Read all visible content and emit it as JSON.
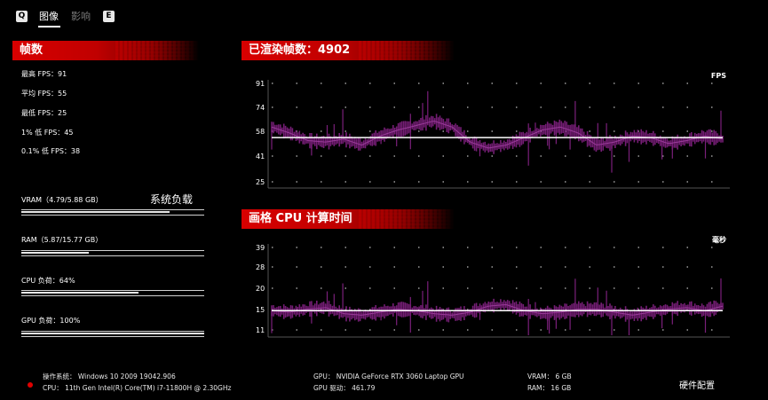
{
  "tabs": [
    {
      "key": "Q"
    },
    {
      "label": "图像"
    },
    {
      "label": "影响"
    },
    {
      "key": "E"
    }
  ],
  "frames_panel": {
    "title": "帧数",
    "stats": [
      "最高 FPS：91",
      "平均 FPS：55",
      "最低 FPS：25",
      "1% 低 FPS：45",
      "0.1% 低 FPS：38"
    ]
  },
  "system_load": {
    "title": "系统负载",
    "items": [
      {
        "label": "VRAM（4.79/5.88 GB）",
        "fraction": 0.81
      },
      {
        "label": "RAM（5.87/15.77 GB）",
        "fraction": 0.37
      },
      {
        "label": "CPU 负荷：64%",
        "fraction": 0.64
      },
      {
        "label": "GPU 负荷：100%",
        "fraction": 1.0
      }
    ]
  },
  "fps_chart": {
    "header": "已渲染帧数：4902",
    "unit": "FPS",
    "ticks": [
      "91",
      "74",
      "58",
      "41",
      "25"
    ],
    "line_color": "#7a1f7a",
    "avg_color": "#ffffff"
  },
  "cpu_chart": {
    "header": "画格 CPU 计算时间",
    "unit": "毫秒",
    "ticks": [
      "39",
      "28",
      "20",
      "15",
      "11"
    ],
    "line_color": "#7a1f7a",
    "avg_color": "#ffffff"
  },
  "chart_data": [
    {
      "type": "line",
      "title": "已渲染帧数：4902",
      "ylabel": "FPS",
      "yticks": [
        91,
        74,
        58,
        41,
        25
      ],
      "ylim": [
        25,
        91
      ],
      "series": [
        {
          "values": [
            62,
            58,
            53,
            52,
            54,
            50,
            56,
            60,
            63,
            66,
            62,
            52,
            48,
            50,
            55,
            60,
            62,
            58,
            50,
            52,
            56,
            55,
            51,
            53,
            56,
            54
          ]
        }
      ],
      "average": 55
    },
    {
      "type": "line",
      "title": "画格 CPU 计算时间",
      "ylabel": "毫秒",
      "yticks": [
        39,
        28,
        20,
        15,
        11
      ],
      "ylim": [
        11,
        39
      ],
      "series": [
        {
          "values": [
            18.0,
            17.5,
            18.5,
            19.0,
            17.0,
            16.5,
            17.5,
            18.5,
            18.0,
            17.0,
            16.5,
            17.5,
            19.5,
            20.0,
            18.0,
            17.0,
            17.5,
            18.5,
            18.5,
            17.5,
            16.5,
            17.5,
            18.5,
            19.0,
            18.0,
            19.5
          ]
        }
      ],
      "average": 18
    }
  ],
  "footer": {
    "os_label": "操作系统：",
    "os_value": "Windows 10 2009 19042.906",
    "cpu_label": "CPU：",
    "cpu_value": "11th Gen Intel(R) Core(TM) i7-11800H @ 2.30GHz",
    "gpu_label": "GPU：",
    "gpu_value": "NVIDIA GeForce RTX 3060 Laptop GPU",
    "driver_label": "GPU 驱动：",
    "driver_value": "461.79",
    "vram_label": "VRAM：",
    "vram_value": "6 GB",
    "ram_label": "RAM：",
    "ram_value": "16 GB",
    "hw_button": "硬件配置"
  }
}
